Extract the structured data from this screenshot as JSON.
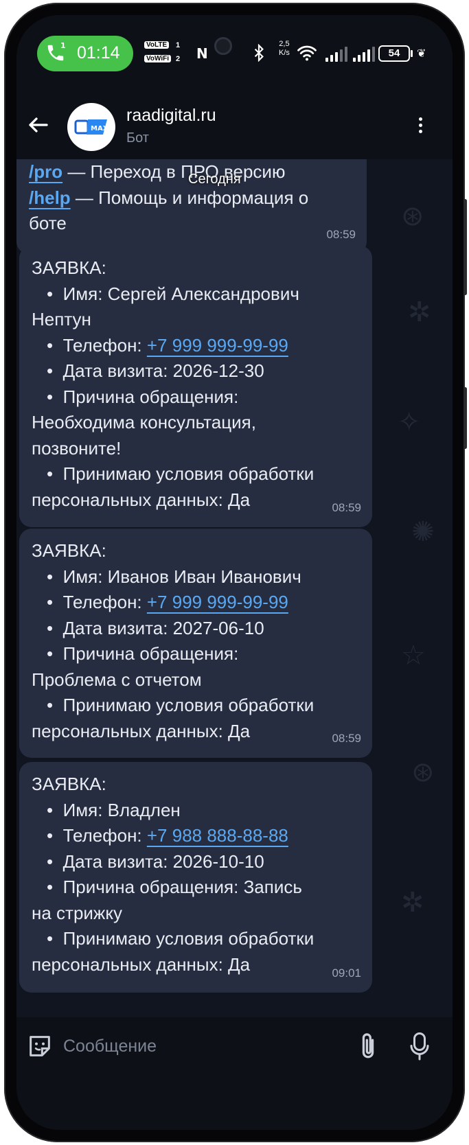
{
  "status": {
    "call_indicator": "1",
    "call_time": "01:14",
    "volte_label": "VoLTE",
    "volte_num": "1",
    "vowifi_label": "VoWiFi",
    "vowifi_num": "2",
    "nfc": "N",
    "speed_top": "2,5",
    "speed_bottom": "K/s",
    "battery": "54"
  },
  "header": {
    "title": "raadigital.ru",
    "subtitle": "Бот",
    "avatar_text": "MAX"
  },
  "date_chip": "Сегодня",
  "messages": [
    {
      "lines": [
        {
          "cmd": "/pro",
          "text": " — Переход в ПРО версию"
        },
        {
          "cmd": "/help",
          "text": " — Помощь и информация о"
        },
        {
          "text": "боте"
        }
      ],
      "time": "08:59"
    },
    {
      "header": "ЗАЯВКА:",
      "name_label": "Имя: Сергей Александрович",
      "name_cont": "Нептун",
      "phone_label": "Телефон: ",
      "phone": "+7 999 999-99-99",
      "date_label": "Дата визита: 2026-12-30",
      "reason_label": "Причина обращения:",
      "reason_1": "Необходима консультация,",
      "reason_2": "позвоните!",
      "consent_1": "Принимаю условия обработки",
      "consent_2": "персональных данных: Да",
      "time": "08:59"
    },
    {
      "header": "ЗАЯВКА:",
      "name_label": "Имя: Иванов Иван Иванович",
      "phone_label": "Телефон: ",
      "phone": "+7 999 999-99-99",
      "date_label": "Дата визита: 2027-06-10",
      "reason_label": "Причина обращения:",
      "reason_1": "Проблема с отчетом",
      "consent_1": "Принимаю условия обработки",
      "consent_2": "персональных данных: Да",
      "time": "08:59"
    },
    {
      "header": "ЗАЯВКА:",
      "name_label": "Имя: Владлен",
      "phone_label": "Телефон: ",
      "phone": "+7 988 888-88-88",
      "date_label": "Дата визита: 2026-10-10",
      "reason_label": "Причина обращения: Запись",
      "reason_1": "на стрижку",
      "consent_1": "Принимаю условия обработки",
      "consent_2": "персональных данных: Да",
      "time": "09:01"
    }
  ],
  "input": {
    "placeholder": "Сообщение"
  },
  "colors": {
    "accent_link": "#5aa8f2",
    "bubble": "#272d40",
    "call_pill": "#46c24b"
  }
}
